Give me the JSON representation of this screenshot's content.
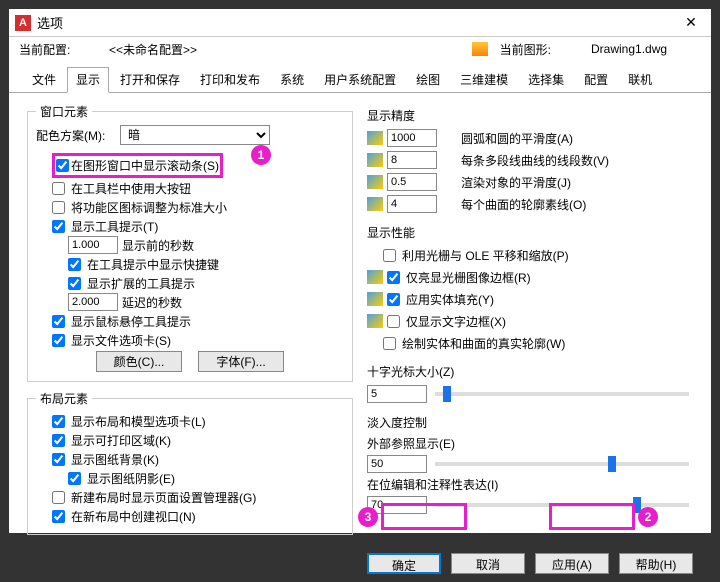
{
  "titlebar": {
    "logo": "A",
    "title": "选项"
  },
  "profile": {
    "curLabel": "当前配置:",
    "curValue": "<<未命名配置>>",
    "drawLabel": "当前图形:",
    "drawValue": "Drawing1.dwg"
  },
  "tabs": [
    "文件",
    "显示",
    "打开和保存",
    "打印和发布",
    "系统",
    "用户系统配置",
    "绘图",
    "三维建模",
    "选择集",
    "配置",
    "联机"
  ],
  "activeTab": 1,
  "left": {
    "windowElements": {
      "legend": "窗口元素",
      "colorSchemeLabel": "配色方案(M):",
      "colorSchemeValue": "暗",
      "showScroll": "在图形窗口中显示滚动条(S)",
      "useLargeBtn": "在工具栏中使用大按钮",
      "resizeRibbon": "将功能区图标调整为标准大小",
      "showTooltip": "显示工具提示(T)",
      "tooltipSecVal": "1.000",
      "tooltipSecLabel": "显示前的秒数",
      "showShortcut": "在工具提示中显示快捷键",
      "showExtTooltip": "显示扩展的工具提示",
      "extDelayVal": "2.000",
      "extDelayLabel": "延迟的秒数",
      "showHover": "显示鼠标悬停工具提示",
      "showFileTabs": "显示文件选项卡(S)",
      "colorsBtn": "颜色(C)...",
      "fontsBtn": "字体(F)..."
    },
    "layoutElements": {
      "legend": "布局元素",
      "showTabs": "显示布局和模型选项卡(L)",
      "showPrintable": "显示可打印区域(K)",
      "showPaperBg": "显示图纸背景(K)",
      "showPaperShadow": "显示图纸阴影(E)",
      "newLayoutPageSetup": "新建布局时显示页面设置管理器(G)",
      "newLayoutViewport": "在新布局中创建视口(N)"
    }
  },
  "right": {
    "precision": {
      "legend": "显示精度",
      "arcVal": "1000",
      "arcLabel": "圆弧和圆的平滑度(A)",
      "segVal": "8",
      "segLabel": "每条多段线曲线的线段数(V)",
      "renderVal": "0.5",
      "renderLabel": "渲染对象的平滑度(J)",
      "surfVal": "4",
      "surfLabel": "每个曲面的轮廓素线(O)"
    },
    "perf": {
      "legend": "显示性能",
      "panZoom": "利用光栅与 OLE 平移和缩放(P)",
      "hlRaster": "仅亮显光栅图像边框(R)",
      "solidFill": "应用实体填充(Y)",
      "textFrame": "仅显示文字边框(X)",
      "trueSil": "绘制实体和曲面的真实轮廓(W)"
    },
    "crosshair": {
      "legend": "十字光标大小(Z)",
      "val": "5"
    },
    "fade": {
      "legend": "淡入度控制",
      "xrefLabel": "外部参照显示(E)",
      "xrefVal": "50",
      "editLabel": "在位编辑和注释性表达(I)",
      "editVal": "70"
    }
  },
  "footer": {
    "ok": "确定",
    "cancel": "取消",
    "apply": "应用(A)",
    "help": "帮助(H)"
  },
  "callouts": {
    "c1": "1",
    "c2": "2",
    "c3": "3"
  }
}
